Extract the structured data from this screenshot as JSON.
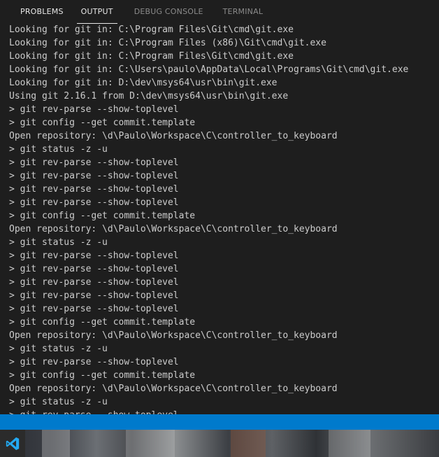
{
  "tabs": [
    {
      "label": "PROBLEMS"
    },
    {
      "label": "OUTPUT"
    },
    {
      "label": "DEBUG CONSOLE"
    },
    {
      "label": "TERMINAL"
    }
  ],
  "active_tab": "OUTPUT",
  "output_lines": [
    "Looking for git in: C:\\Program Files\\Git\\cmd\\git.exe",
    "Looking for git in: C:\\Program Files (x86)\\Git\\cmd\\git.exe",
    "Looking for git in: C:\\Program Files\\Git\\cmd\\git.exe",
    "Looking for git in: C:\\Users\\paulo\\AppData\\Local\\Programs\\Git\\cmd\\git.exe",
    "Looking for git in: D:\\dev\\msys64\\usr\\bin\\git.exe",
    "Using git 2.16.1 from D:\\dev\\msys64\\usr\\bin\\git.exe",
    "> git rev-parse --show-toplevel",
    "> git config --get commit.template",
    "Open repository: \\d\\Paulo\\Workspace\\C\\controller_to_keyboard",
    "> git status -z -u",
    "> git rev-parse --show-toplevel",
    "> git rev-parse --show-toplevel",
    "> git rev-parse --show-toplevel",
    "> git rev-parse --show-toplevel",
    "> git config --get commit.template",
    "Open repository: \\d\\Paulo\\Workspace\\C\\controller_to_keyboard",
    "> git status -z -u",
    "> git rev-parse --show-toplevel",
    "> git rev-parse --show-toplevel",
    "> git rev-parse --show-toplevel",
    "> git rev-parse --show-toplevel",
    "> git rev-parse --show-toplevel",
    "> git config --get commit.template",
    "Open repository: \\d\\Paulo\\Workspace\\C\\controller_to_keyboard",
    "> git status -z -u",
    "> git rev-parse --show-toplevel",
    "> git config --get commit.template",
    "Open repository: \\d\\Paulo\\Workspace\\C\\controller_to_keyboard",
    "> git status -z -u",
    "> git rev-parse --show-toplevel"
  ],
  "taskbar": {
    "icon": "vscode-icon"
  },
  "colors": {
    "panel_bg": "#1e1e1e",
    "text": "#cccccc",
    "statusbar": "#007acc",
    "tab_inactive": "#8b8b8b",
    "tab_active": "#e7e7e7"
  }
}
